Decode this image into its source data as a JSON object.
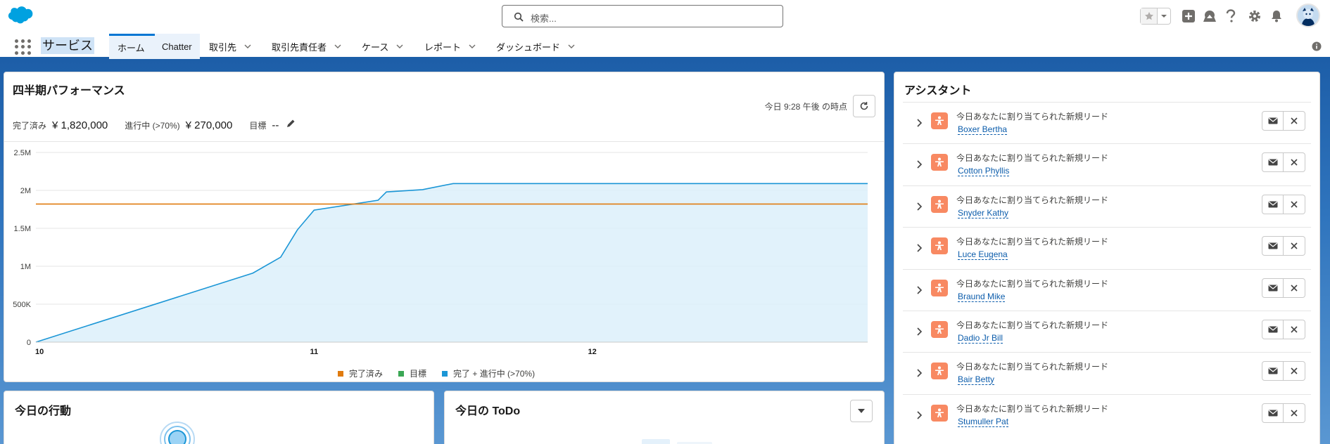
{
  "header": {
    "search_placeholder": "検索...",
    "icons": [
      "favorites-star-icon",
      "favorites-dropdown-icon",
      "add-icon",
      "trailhead-icon",
      "help-icon",
      "setup-gear-icon",
      "notification-bell-icon",
      "user-avatar"
    ]
  },
  "nav": {
    "app_name": "サービス",
    "tabs": [
      {
        "label": "ホーム",
        "active": true,
        "dropdown": false
      },
      {
        "label": "Chatter",
        "active": false,
        "dropdown": false
      },
      {
        "label": "取引先",
        "active": false,
        "dropdown": true
      },
      {
        "label": "取引先責任者",
        "active": false,
        "dropdown": true
      },
      {
        "label": "ケース",
        "active": false,
        "dropdown": true
      },
      {
        "label": "レポート",
        "active": false,
        "dropdown": true
      },
      {
        "label": "ダッシュボード",
        "active": false,
        "dropdown": true
      }
    ]
  },
  "performance": {
    "title": "四半期パフォーマンス",
    "as_of": "今日 9:28 午後 の時点",
    "closed_label": "完了済み",
    "closed_value": "¥ 1,820,000",
    "open_label": "進行中 (>70%)",
    "open_value": "¥ 270,000",
    "goal_label": "目標",
    "goal_value": "--"
  },
  "chart_data": {
    "type": "line",
    "x_ticks": [
      "10",
      "11",
      "12"
    ],
    "y_ticks": [
      "0",
      "500K",
      "1M",
      "1.5M",
      "2M",
      "2.5M"
    ],
    "ylim": [
      0,
      2500000
    ],
    "legend": [
      {
        "label": "完了済み",
        "color": "#e07b0f"
      },
      {
        "label": "目標",
        "color": "#3ba755"
      },
      {
        "label": "完了 + 進行中 (>70%)",
        "color": "#1b96d6"
      }
    ],
    "series": [
      {
        "name": "完了済み",
        "x": [
          10,
          12.99
        ],
        "y": [
          1820000,
          1820000
        ]
      },
      {
        "name": "完了 + 進行中 (>70%)",
        "x": [
          10,
          10.78,
          10.88,
          10.94,
          11.0,
          11.23,
          11.26,
          11.39,
          11.5,
          12.99
        ],
        "y": [
          0,
          910000,
          1120000,
          1480000,
          1740000,
          1870000,
          1980000,
          2010000,
          2090000,
          2090000
        ]
      }
    ]
  },
  "assistant": {
    "title": "アシスタント",
    "items": [
      {
        "message": "今日あなたに割り当てられた新規リード",
        "name": "Boxer Bertha"
      },
      {
        "message": "今日あなたに割り当てられた新規リード",
        "name": "Cotton Phyllis"
      },
      {
        "message": "今日あなたに割り当てられた新規リード",
        "name": "Snyder Kathy"
      },
      {
        "message": "今日あなたに割り当てられた新規リード",
        "name": "Luce Eugena"
      },
      {
        "message": "今日あなたに割り当てられた新規リード",
        "name": "Braund Mike"
      },
      {
        "message": "今日あなたに割り当てられた新規リード",
        "name": "Dadio Jr Bill"
      },
      {
        "message": "今日あなたに割り当てられた新規リード",
        "name": "Bair Betty"
      },
      {
        "message": "今日あなたに割り当てられた新規リード",
        "name": "Stumuller Pat"
      }
    ]
  },
  "events": {
    "title": "今日の行動"
  },
  "todo": {
    "title": "今日の ToDo"
  }
}
